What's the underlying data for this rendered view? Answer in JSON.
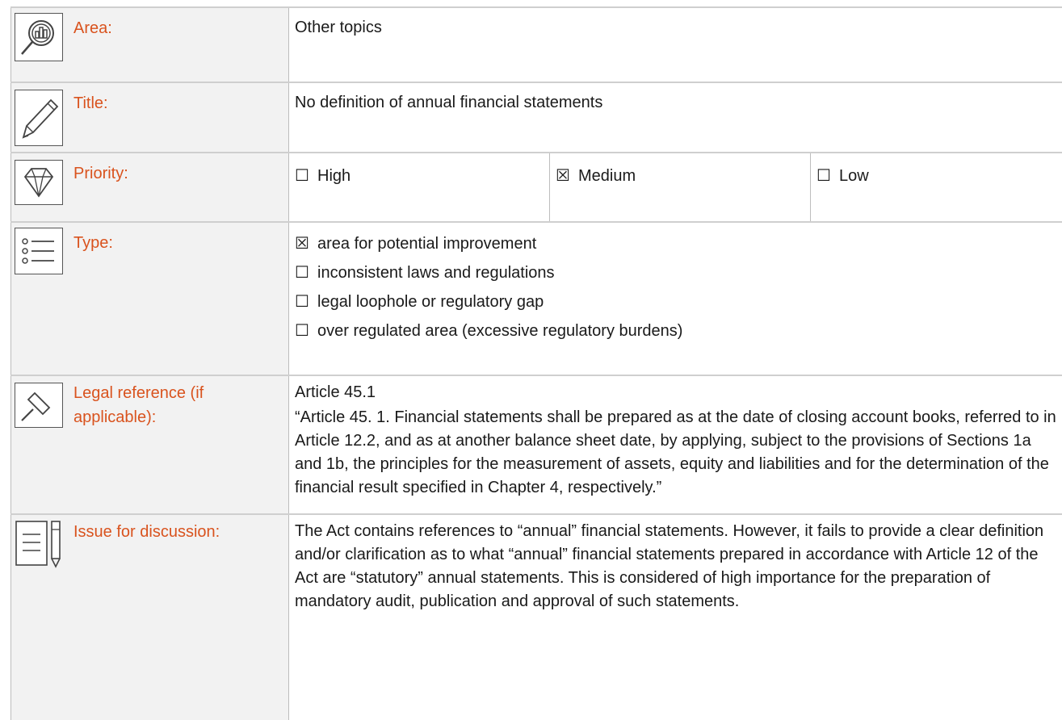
{
  "rows": {
    "area": {
      "label": "Area:",
      "value": "Other topics",
      "icon": "magnifier-chart-icon"
    },
    "title": {
      "label": "Title:",
      "value": "No definition of annual financial statements",
      "icon": "pencil-icon"
    },
    "priority": {
      "label": "Priority:",
      "icon": "diamond-icon",
      "options": [
        {
          "box": "☐",
          "text": "High"
        },
        {
          "box": "☒",
          "text": "Medium"
        },
        {
          "box": "☐",
          "text": "Low"
        }
      ]
    },
    "type": {
      "label": "Type:",
      "icon": "list-icon",
      "options": [
        {
          "box": "☒",
          "text": "area for potential improvement"
        },
        {
          "box": "☐",
          "text": "inconsistent laws and regulations"
        },
        {
          "box": "☐",
          "text": "legal loophole or regulatory gap"
        },
        {
          "box": "☐",
          "text": "over regulated area (excessive regulatory burdens)"
        }
      ]
    },
    "legal": {
      "label_line1": "Legal reference (if",
      "label_line2": "applicable):",
      "icon": "gavel-icon",
      "ref": "Article 45.1",
      "quote": "“Article 45. 1. Financial statements shall be prepared as at the date of closing account books, referred to in Article 12.2, and as at another balance sheet date, by applying, subject to the provisions of Sections 1a and 1b, the principles for the measurement of assets, equity and liabilities and for the determination of the financial result specified in Chapter 4, respectively.”"
    },
    "issue": {
      "label": "Issue for discussion:",
      "icon": "document-pen-icon",
      "text": "The Act contains references to “annual” financial statements. However, it fails to provide a clear definition and/or clarification as to what “annual” financial statements prepared in accordance with Article 12 of the Act are “statutory” annual statements. This is considered of high importance for the preparation of mandatory audit, publication and approval of such statements."
    }
  },
  "colors": {
    "label": "#d9531e",
    "label_bg": "#f2f2f2",
    "border": "#bdbdbd"
  }
}
